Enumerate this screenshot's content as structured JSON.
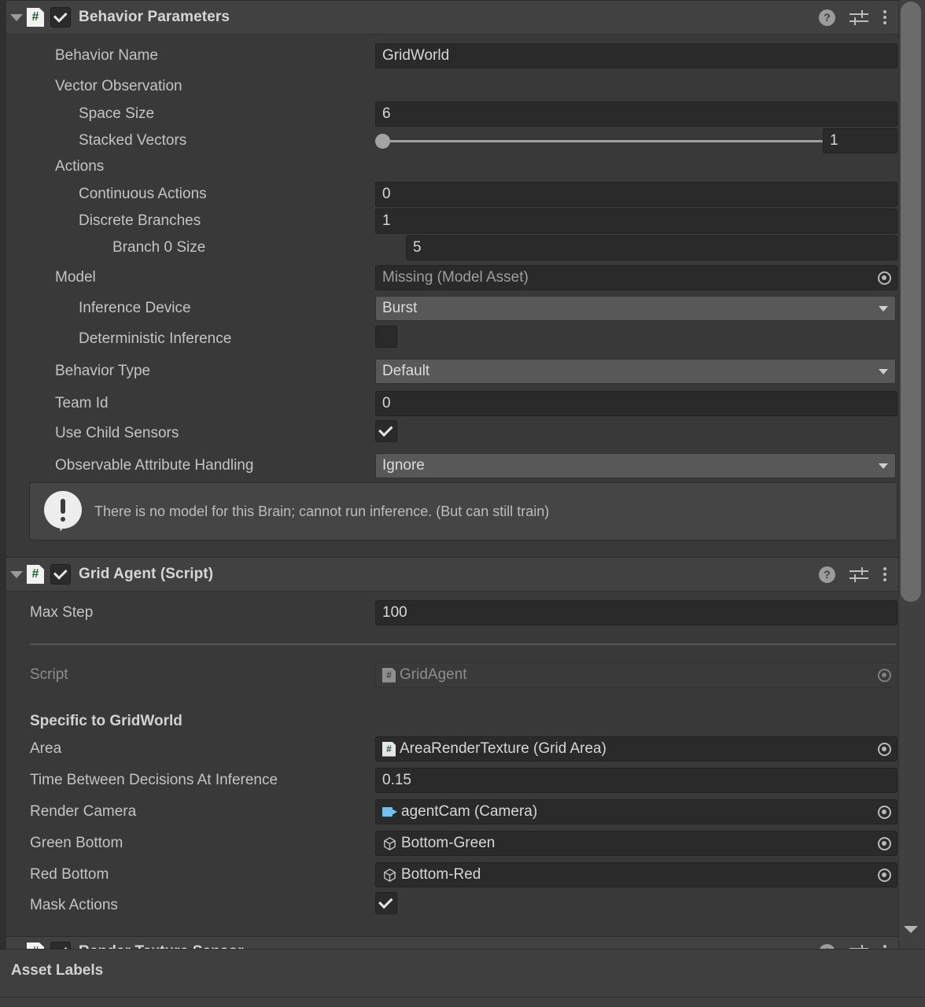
{
  "components": [
    {
      "title": "Behavior Parameters",
      "enabled": true,
      "icons": {
        "help": "?",
        "preset": "preset-icon",
        "menu": "more-menu-icon"
      },
      "rows": [
        {
          "label": "Behavior Name",
          "type": "text",
          "value": "GridWorld",
          "indent": 0
        },
        {
          "label": "Vector Observation",
          "type": "header",
          "indent": 0
        },
        {
          "label": "Space Size",
          "type": "text",
          "value": "6",
          "indent": 1
        },
        {
          "label": "Stacked Vectors",
          "type": "slider",
          "value": "1",
          "indent": 1
        },
        {
          "label": "Actions",
          "type": "header",
          "indent": 0
        },
        {
          "label": "Continuous Actions",
          "type": "text",
          "value": "0",
          "indent": 1
        },
        {
          "label": "Discrete Branches",
          "type": "text",
          "value": "1",
          "indent": 1
        },
        {
          "label": "Branch 0 Size",
          "type": "text",
          "value": "5",
          "indent": 2
        },
        {
          "label": "Model",
          "type": "object",
          "value": "Missing (Model Asset)",
          "icon": "none",
          "indent": 0
        },
        {
          "label": "Inference Device",
          "type": "popup",
          "value": "Burst",
          "indent": 1
        },
        {
          "label": "Deterministic Inference",
          "type": "checkbox",
          "value": false,
          "indent": 1
        },
        {
          "label": "Behavior Type",
          "type": "popup",
          "value": "Default",
          "indent": 0
        },
        {
          "label": "Team Id",
          "type": "text",
          "value": "0",
          "indent": 0
        },
        {
          "label": "Use Child Sensors",
          "type": "checkbox",
          "value": true,
          "indent": 0
        },
        {
          "label": "Observable Attribute Handling",
          "type": "popup",
          "value": "Ignore",
          "indent": 0
        }
      ],
      "help_message": "There is no model for this Brain; cannot run inference. (But can still train)"
    },
    {
      "title": "Grid Agent (Script)",
      "enabled": true,
      "rows": [
        {
          "label": "Max Step",
          "type": "text",
          "value": "100"
        },
        {
          "label": "Script",
          "type": "object",
          "value": "GridAgent",
          "icon": "script",
          "disabled": true
        }
      ],
      "section_title": "Specific to GridWorld",
      "section_rows": [
        {
          "label": "Area",
          "type": "object",
          "value": "AreaRenderTexture (Grid Area)",
          "icon": "script"
        },
        {
          "label": "Time Between Decisions At Inference",
          "type": "text",
          "value": "0.15"
        },
        {
          "label": "Render Camera",
          "type": "object",
          "value": "agentCam (Camera)",
          "icon": "camera"
        },
        {
          "label": "Green Bottom",
          "type": "object",
          "value": "Bottom-Green",
          "icon": "cube"
        },
        {
          "label": "Red Bottom",
          "type": "object",
          "value": "Bottom-Red",
          "icon": "cube"
        },
        {
          "label": "Mask Actions",
          "type": "checkbox",
          "value": true
        }
      ]
    },
    {
      "title": "Render Texture Sensor",
      "enabled": true
    }
  ],
  "asset_labels": {
    "title": "Asset Labels"
  },
  "colors": {
    "panel_bg": "#393939",
    "header_bg": "#414141",
    "field_bg": "#2a2a2a",
    "popup_bg": "#585858",
    "text": "#c4c4c4",
    "script_green": "#1c5a2a",
    "camera_blue": "#6ec2f0"
  }
}
